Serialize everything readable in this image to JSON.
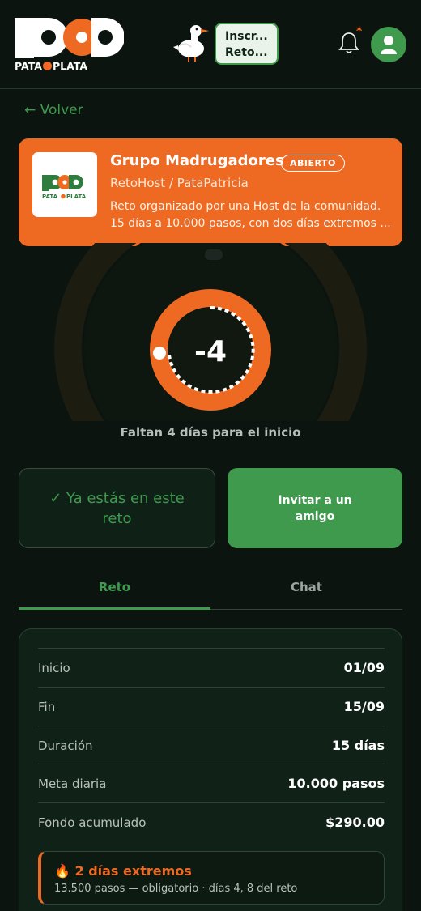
{
  "header": {
    "logo_text": "PP",
    "logo_sub_left": "PATA",
    "logo_sub_right": "PLATA",
    "bubble_line1": "Inscr...",
    "bubble_line2": "Reto...",
    "notification_icon": "bell-icon",
    "avatar_icon": "user-icon"
  },
  "back_label": "← Volver",
  "challenge": {
    "title": "Grupo Madrugadores",
    "status_badge": "ABIERTO",
    "host": "RetoHost / PataPatricia",
    "description_line1": "Reto organizado por una Host de la comunidad.",
    "description_line2": "15 días a 10.000 pasos, con dos días extremos ..."
  },
  "countdown": {
    "value": "-4",
    "label": "Faltan 4 días para el inicio"
  },
  "actions": {
    "joined_label": "✓ Ya estás en este reto",
    "invite_label": "Invitar a un amigo"
  },
  "tabs": [
    {
      "label": "Reto",
      "active": true
    },
    {
      "label": "Chat",
      "active": false
    }
  ],
  "details": [
    {
      "key": "Inicio",
      "value": "01/09"
    },
    {
      "key": "Fin",
      "value": "15/09"
    },
    {
      "key": "Duración",
      "value": "15 días"
    },
    {
      "key": "Meta diaria",
      "value": "10.000 pasos"
    },
    {
      "key": "Fondo acumulado",
      "value": "$290.00"
    }
  ],
  "extreme": {
    "title": "🔥 2 días extremos",
    "subtitle": "13.500 pasos — obligatorio · días 4, 8 del reto"
  },
  "colors": {
    "background": "#0b140f",
    "brand_orange": "#ee6a22",
    "brand_green": "#3f9a4e"
  }
}
